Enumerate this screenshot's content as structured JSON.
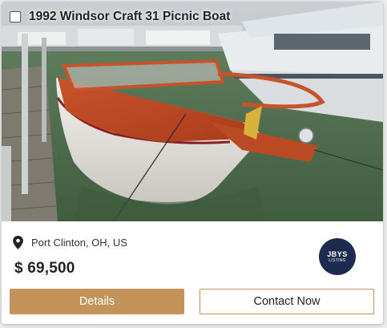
{
  "listing": {
    "title": "1992 Windsor Craft 31 Picnic Boat",
    "location": "Port Clinton, OH, US",
    "price": "$ 69,500",
    "badge": {
      "line1": "JBYS",
      "line2": "LISTING"
    }
  },
  "actions": {
    "details_label": "Details",
    "contact_label": "Contact Now"
  },
  "icons": {
    "location": "map-pin-icon",
    "select": "checkbox"
  },
  "colors": {
    "accent": "#c4935a",
    "badge_bg": "#1d2b4f"
  }
}
